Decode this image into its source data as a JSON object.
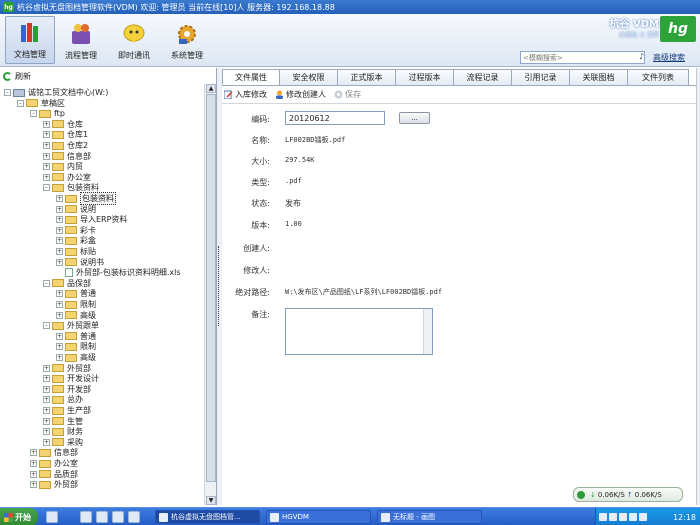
{
  "window": {
    "logo": "hg",
    "title": "杭谷虚拟无盘图档管理软件(VDM) 欢迎: 管理员 当前在线[10]人 服务器: 192.168.18.88"
  },
  "toolbar": {
    "items": [
      {
        "label": "文档管理",
        "icon": "documents-icon",
        "active": true
      },
      {
        "label": "流程管理",
        "icon": "workflow-icon",
        "active": false
      },
      {
        "label": "即时通讯",
        "icon": "chat-icon",
        "active": false
      },
      {
        "label": "系统管理",
        "icon": "settings-icon",
        "active": false
      }
    ],
    "brand_name": "杭谷 VDM",
    "brand_tag": "价值创 义 变革",
    "brand_logo": "hg",
    "search_placeholder": "<模糊搜索>",
    "search_button": "♪",
    "advanced_search": "高级搜索"
  },
  "tree": {
    "refresh_label": "刷新",
    "nodes": [
      {
        "label": "诚铭工贸文档中心(W:)",
        "level": 0,
        "toggle": "-",
        "kind": "pc"
      },
      {
        "label": "草稿区",
        "level": 1,
        "toggle": "-",
        "kind": "folder"
      },
      {
        "label": "ftp",
        "level": 2,
        "toggle": "-",
        "kind": "folder"
      },
      {
        "label": "仓库",
        "level": 3,
        "toggle": "+",
        "kind": "folder"
      },
      {
        "label": "仓库1",
        "level": 3,
        "toggle": "+",
        "kind": "folder"
      },
      {
        "label": "仓库2",
        "level": 3,
        "toggle": "+",
        "kind": "folder"
      },
      {
        "label": "信息部",
        "level": 3,
        "toggle": "+",
        "kind": "folder"
      },
      {
        "label": "内贸",
        "level": 3,
        "toggle": "+",
        "kind": "folder"
      },
      {
        "label": "办公室",
        "level": 3,
        "toggle": "+",
        "kind": "folder"
      },
      {
        "label": "包装资料",
        "level": 3,
        "toggle": "-",
        "kind": "folder"
      },
      {
        "label": "包装资料",
        "level": 4,
        "toggle": "+",
        "kind": "folder",
        "selected": true
      },
      {
        "label": "说明",
        "level": 4,
        "toggle": "+",
        "kind": "folder"
      },
      {
        "label": "导入ERP资料",
        "level": 4,
        "toggle": "+",
        "kind": "folder"
      },
      {
        "label": "彩卡",
        "level": 4,
        "toggle": "+",
        "kind": "folder"
      },
      {
        "label": "彩盒",
        "level": 4,
        "toggle": "+",
        "kind": "folder"
      },
      {
        "label": "标贴",
        "level": 4,
        "toggle": "+",
        "kind": "folder"
      },
      {
        "label": "说明书",
        "level": 4,
        "toggle": "+",
        "kind": "folder"
      },
      {
        "label": "外贸部-包装标识资料明细.xls",
        "level": 4,
        "toggle": "",
        "kind": "file"
      },
      {
        "label": "品保部",
        "level": 3,
        "toggle": "-",
        "kind": "folder"
      },
      {
        "label": "普通",
        "level": 4,
        "toggle": "+",
        "kind": "folder"
      },
      {
        "label": "限制",
        "level": 4,
        "toggle": "+",
        "kind": "folder"
      },
      {
        "label": "高级",
        "level": 4,
        "toggle": "+",
        "kind": "folder"
      },
      {
        "label": "外贸跟单",
        "level": 3,
        "toggle": "-",
        "kind": "folder"
      },
      {
        "label": "普通",
        "level": 4,
        "toggle": "+",
        "kind": "folder"
      },
      {
        "label": "限制",
        "level": 4,
        "toggle": "+",
        "kind": "folder"
      },
      {
        "label": "高级",
        "level": 4,
        "toggle": "+",
        "kind": "folder"
      },
      {
        "label": "外贸部",
        "level": 3,
        "toggle": "+",
        "kind": "folder"
      },
      {
        "label": "开发设计",
        "level": 3,
        "toggle": "+",
        "kind": "folder"
      },
      {
        "label": "开发部",
        "level": 3,
        "toggle": "+",
        "kind": "folder"
      },
      {
        "label": "总办",
        "level": 3,
        "toggle": "+",
        "kind": "folder"
      },
      {
        "label": "生产部",
        "level": 3,
        "toggle": "+",
        "kind": "folder"
      },
      {
        "label": "生管",
        "level": 3,
        "toggle": "+",
        "kind": "folder"
      },
      {
        "label": "财务",
        "level": 3,
        "toggle": "+",
        "kind": "folder"
      },
      {
        "label": "采购",
        "level": 3,
        "toggle": "+",
        "kind": "folder"
      },
      {
        "label": "信息部",
        "level": 2,
        "toggle": "+",
        "kind": "folder"
      },
      {
        "label": "办公室",
        "level": 2,
        "toggle": "+",
        "kind": "folder"
      },
      {
        "label": "品质部",
        "level": 2,
        "toggle": "+",
        "kind": "folder"
      },
      {
        "label": "外贸部",
        "level": 2,
        "toggle": "+",
        "kind": "folder"
      }
    ]
  },
  "tabs": [
    {
      "label": "文件属性",
      "active": true
    },
    {
      "label": "安全权限",
      "active": false
    },
    {
      "label": "正式版本",
      "active": false
    },
    {
      "label": "过程版本",
      "active": false
    },
    {
      "label": "流程记录",
      "active": false
    },
    {
      "label": "引用记录",
      "active": false
    },
    {
      "label": "关联图档",
      "active": false
    },
    {
      "label": "文件列表",
      "active": false
    }
  ],
  "actions": [
    {
      "label": "入库修改",
      "icon": "edit-icon",
      "disabled": false
    },
    {
      "label": "修改创建人",
      "icon": "user-icon",
      "disabled": false
    },
    {
      "label": "保存",
      "icon": "save-icon",
      "disabled": true
    }
  ],
  "properties": {
    "code_label": "编码:",
    "code_value": "20120612",
    "browse_button": "...",
    "name_label": "名称:",
    "name_value": "LF002BD镭板.pdf",
    "size_label": "大小:",
    "size_value": "297.54K",
    "type_label": "类型:",
    "type_value": ".pdf",
    "state_label": "状态:",
    "state_value": "发布",
    "version_label": "版本:",
    "version_value": "1.00",
    "creator_label": "创建人:",
    "creator_value": "",
    "modifier_label": "修改人:",
    "modifier_value": "",
    "path_label": "绝对路径:",
    "path_value": "W:\\发布区\\产品图纸\\LF系列\\LF002BD镭板.pdf",
    "remark_label": "备注:",
    "remark_value": ""
  },
  "status": {
    "down_speed": "0.06K/S",
    "up_speed": "0.06K/S"
  },
  "taskbar": {
    "start_label": "开始",
    "tasks": [
      {
        "label": "杭谷虚拟无盘图档管...",
        "active": true
      },
      {
        "label": "HGVDM",
        "active": false
      },
      {
        "label": "无标题 - 画图",
        "active": false
      }
    ],
    "clock": "12:18"
  }
}
